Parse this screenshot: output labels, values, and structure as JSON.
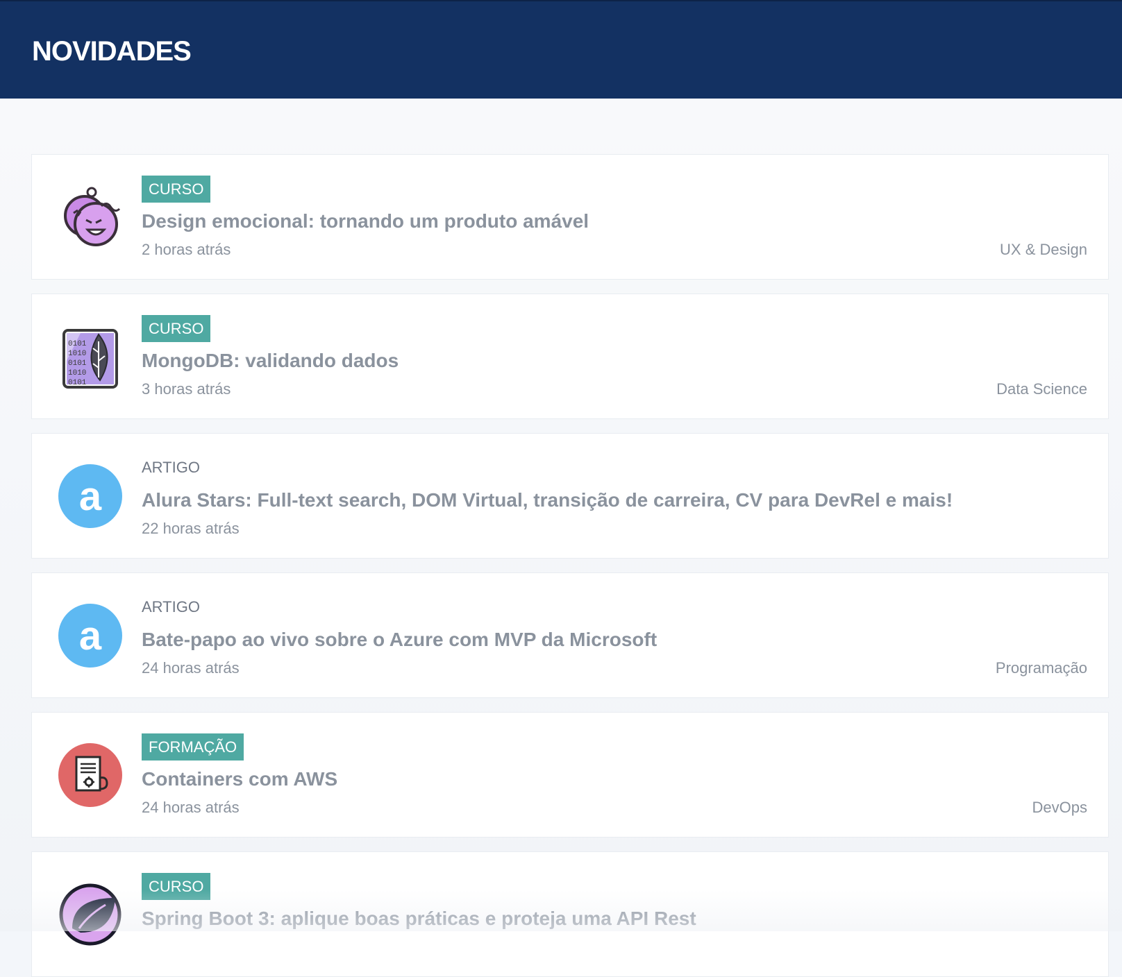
{
  "header": {
    "title": "NOVIDADES"
  },
  "items": [
    {
      "type": "CURSO",
      "title": "Design emocional: tornando um produto amável",
      "time": "2 horas atrás",
      "category": "UX & Design",
      "icon": "emotional-faces-icon"
    },
    {
      "type": "CURSO",
      "title": "MongoDB: validando dados",
      "time": "3 horas atrás",
      "category": "Data Science",
      "icon": "mongodb-leaf-icon"
    },
    {
      "type": "ARTIGO",
      "title": "Alura Stars: Full-text search, DOM Virtual, transição de carreira, CV para DevRel e mais!",
      "time": "22 horas atrás",
      "category": "",
      "icon": "alura-logo-icon"
    },
    {
      "type": "ARTIGO",
      "title": "Bate-papo ao vivo sobre o Azure com MVP da Microsoft",
      "time": "24 horas atrás",
      "category": "Programação",
      "icon": "alura-logo-icon"
    },
    {
      "type": "FORMAÇÃO",
      "title": "Containers com AWS",
      "time": "24 horas atrás",
      "category": "DevOps",
      "icon": "aws-container-icon"
    },
    {
      "type": "CURSO",
      "title": "Spring Boot 3: aplique boas práticas e proteja uma API Rest",
      "time": "",
      "category": "",
      "icon": "spring-leaf-icon"
    }
  ],
  "colors": {
    "header_bg": "#133162",
    "badge_bg": "#4fa9a2",
    "alura_blue": "#5eb9f2",
    "formacao_red": "#e06767"
  }
}
